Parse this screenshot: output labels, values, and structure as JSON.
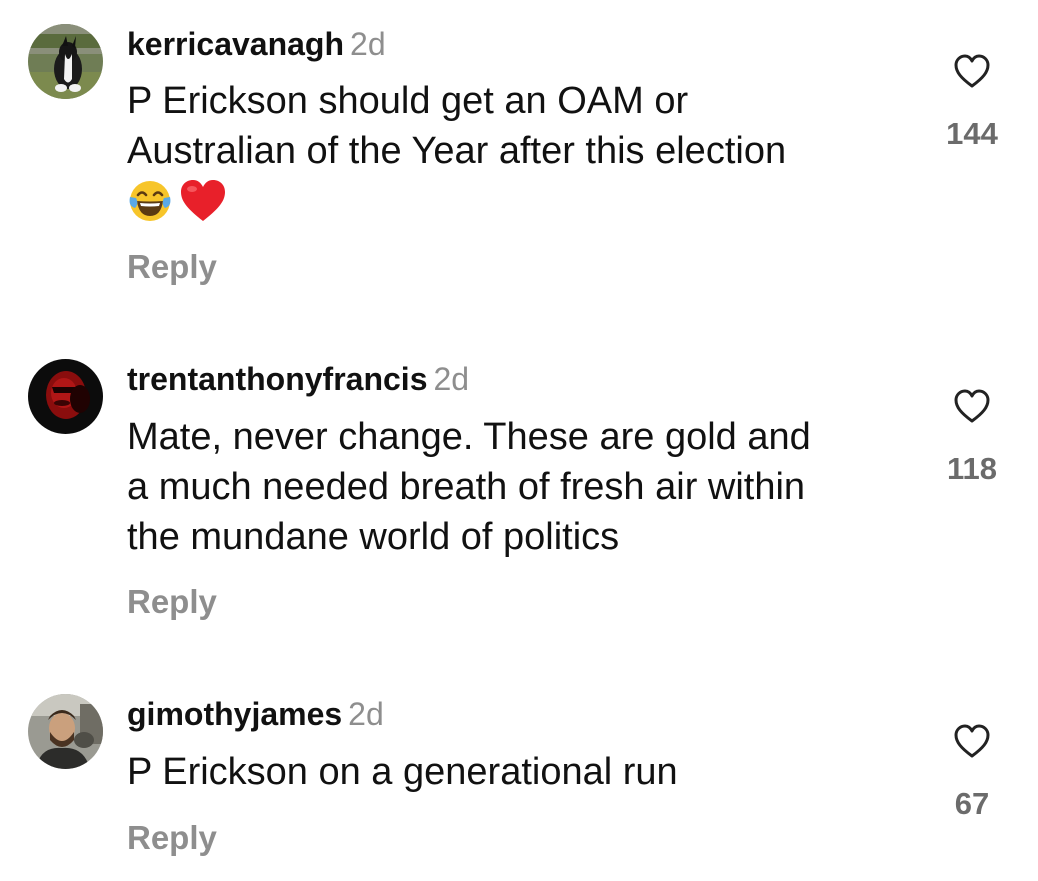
{
  "comments": [
    {
      "username": "kerricavanagh",
      "time": "2d",
      "lines": [
        "P Erickson should get an OAM or",
        "Australian of the Year after this election"
      ],
      "emojis": [
        "laughing-tears-emoji",
        "red-heart-emoji"
      ],
      "reply_label": "Reply",
      "likes": "144",
      "avatar_icon": "dog-avatar"
    },
    {
      "username": "trentanthonyfrancis",
      "time": "2d",
      "lines": [
        "Mate, never change. These are gold and",
        "a much needed breath of fresh air within",
        "the mundane world of politics"
      ],
      "reply_label": "Reply",
      "likes": "118",
      "avatar_icon": "red-portrait-avatar"
    },
    {
      "username": "gimothyjames",
      "time": "2d",
      "lines": [
        "P Erickson on a generational run"
      ],
      "reply_label": "Reply",
      "likes": "67",
      "avatar_icon": "person-avatar"
    }
  ],
  "colors": {
    "text": "#111111",
    "muted": "#8e8e8e",
    "like_count": "#6b6b6b",
    "heart_emoji": "#e8202a",
    "laugh_emoji": "#f7c52a",
    "tear": "#5aa9e6"
  }
}
